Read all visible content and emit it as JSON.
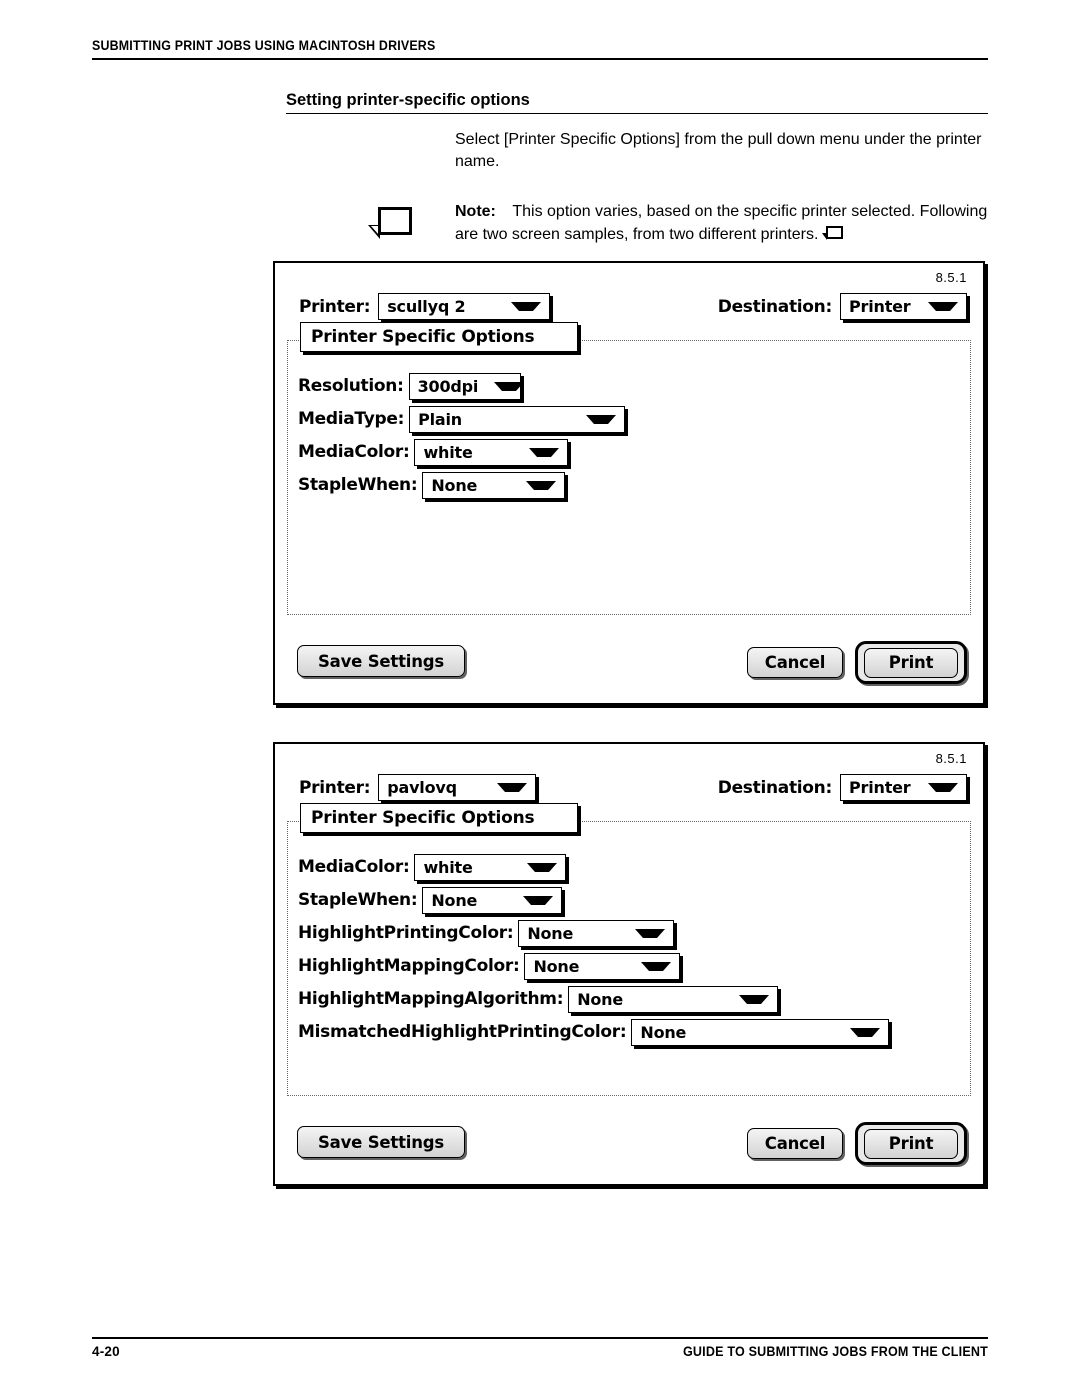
{
  "page": {
    "running_header": "SUBMITTING PRINT JOBS USING MACINTOSH DRIVERS",
    "section_heading": "Setting printer-specific options",
    "body_paragraph": "Select [Printer Specific Options] from the pull down menu under the printer name.",
    "note": {
      "label": "Note:",
      "text": "This option varies, based on the specific printer selected. Following are two screen samples, from two different printers.",
      "icon": "note-sheet-icon",
      "end_marker_icon": "note-end-marker-icon"
    },
    "footer": {
      "page_number": "4-20",
      "guide_title": "GUIDE TO SUBMITTING JOBS FROM THE CLIENT"
    }
  },
  "dialogs": [
    {
      "id": "dialog-1",
      "version": "8.5.1",
      "printer_label": "Printer:",
      "printer_value": "scullyq 2",
      "destination_label": "Destination:",
      "destination_value": "Printer",
      "pane_menu_value": "Printer Specific Options",
      "options": [
        {
          "label": "Resolution:",
          "value": "300dpi",
          "popup_width": 112
        },
        {
          "label": "MediaType:",
          "value": "Plain",
          "popup_width": 216
        },
        {
          "label": "MediaColor:",
          "value": "white",
          "popup_width": 154
        },
        {
          "label": "StapleWhen:",
          "value": "None",
          "popup_width": 143
        }
      ],
      "buttons": {
        "save": "Save Settings",
        "cancel": "Cancel",
        "print": "Print"
      }
    },
    {
      "id": "dialog-2",
      "version": "8.5.1",
      "printer_label": "Printer:",
      "printer_value": "pavlovq",
      "destination_label": "Destination:",
      "destination_value": "Printer",
      "pane_menu_value": "Printer Specific Options",
      "options": [
        {
          "label": "MediaColor:",
          "value": "white",
          "popup_width": 152
        },
        {
          "label": "StapleWhen:",
          "value": "None",
          "popup_width": 140
        },
        {
          "label": "HighlightPrintingColor:",
          "value": "None",
          "popup_width": 156
        },
        {
          "label": "HighlightMappingColor:",
          "value": "None",
          "popup_width": 156
        },
        {
          "label": "HighlightMappingAlgorithm:",
          "value": "None",
          "popup_width": 210
        },
        {
          "label": "MismatchedHighlightPrintingColor:",
          "value": "None",
          "popup_width": 258
        }
      ],
      "buttons": {
        "save": "Save Settings",
        "cancel": "Cancel",
        "print": "Print"
      }
    }
  ],
  "colors": {
    "ink": "#000000",
    "paper": "#ffffff",
    "button_face": "#e2e2e2",
    "panel_border": "#666666"
  }
}
